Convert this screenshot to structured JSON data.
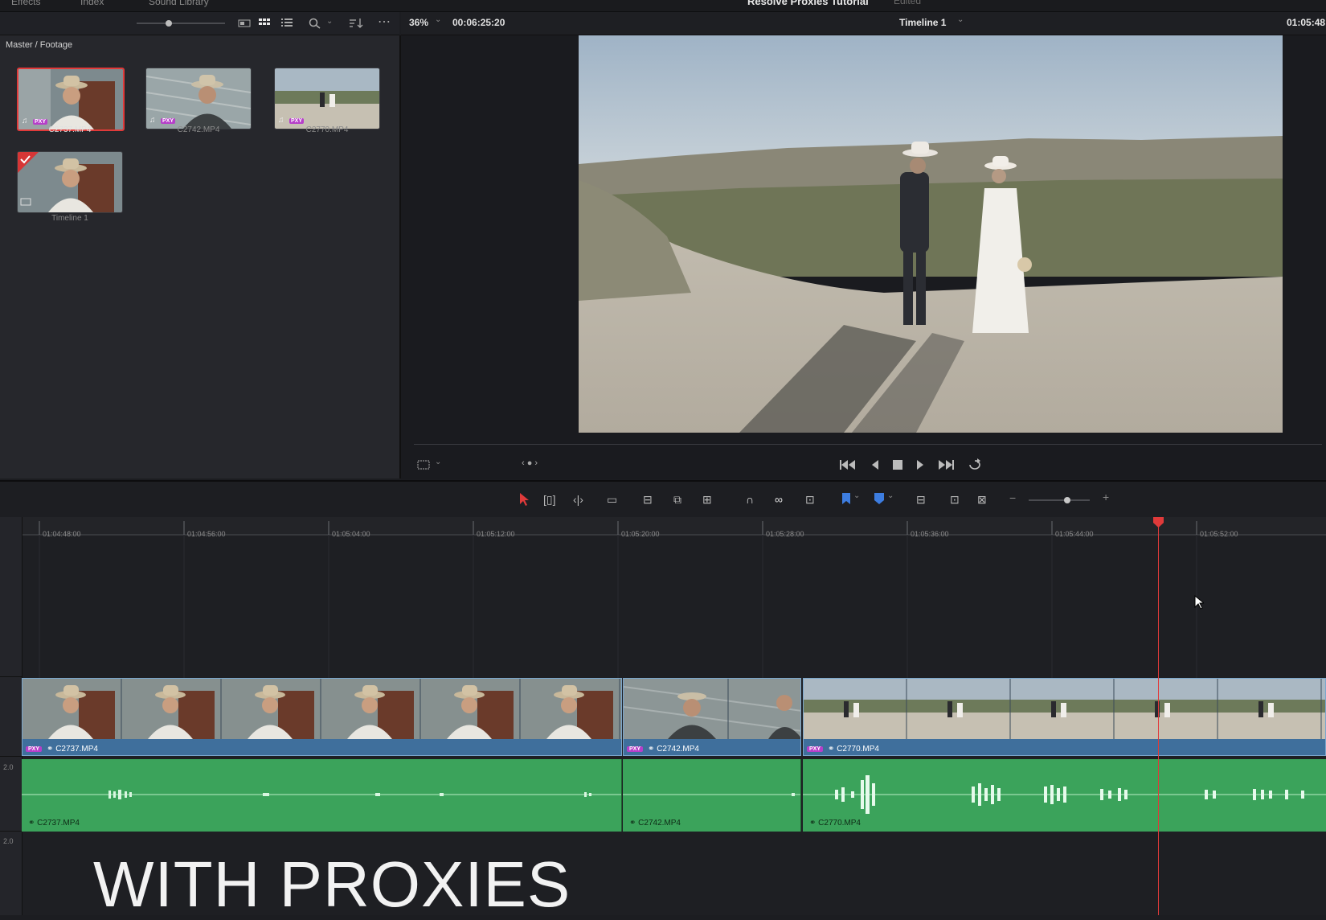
{
  "top_bar": {
    "tabs": [
      "Effects",
      "Index",
      "Sound Library"
    ],
    "project_title": "Resolve Proxies Tutorial",
    "status": "Edited"
  },
  "media_pool": {
    "breadcrumb": "Master / Footage",
    "clips": [
      {
        "name": "C2737.MP4",
        "selected": true,
        "badge": "PXY"
      },
      {
        "name": "C2742.MP4",
        "selected": false,
        "badge": "PXY"
      },
      {
        "name": "C2770.MP4",
        "selected": false,
        "badge": "PXY"
      },
      {
        "name": "Timeline 1",
        "selected": false,
        "badge": ""
      }
    ]
  },
  "viewer": {
    "zoom": "36%",
    "source_timecode": "00:06:25:20",
    "timeline_name": "Timeline 1",
    "record_timecode": "01:05:48"
  },
  "timeline": {
    "ruler": [
      "01:04:48:00",
      "01:04:56:00",
      "01:05:04:00",
      "01:05:12:00",
      "01:05:20:00",
      "01:05:28:00",
      "01:05:36:00",
      "01:05:44:00",
      "01:05:52:00"
    ],
    "video_clips": [
      {
        "name": "C2737.MP4",
        "badge": "PXY"
      },
      {
        "name": "C2742.MP4",
        "badge": "PXY"
      },
      {
        "name": "C2770.MP4",
        "badge": "PXY"
      }
    ],
    "audio_clips": [
      {
        "name": "C2737.MP4"
      },
      {
        "name": "C2742.MP4"
      },
      {
        "name": "C2770.MP4"
      }
    ],
    "track_levels": [
      "2.0",
      "2.0"
    ]
  },
  "overlay_caption": "WITH PROXIES",
  "colors": {
    "playhead": "#e03a3a",
    "video_clip": "#3f6f9c",
    "audio_clip": "#3ba35b",
    "proxy_badge": "#b63fc9"
  }
}
